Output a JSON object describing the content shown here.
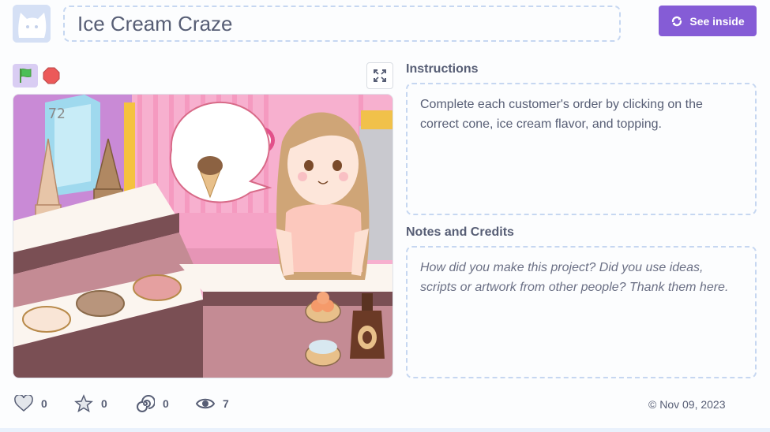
{
  "project": {
    "title": "Ice Cream Craze",
    "see_inside_label": "See inside"
  },
  "stage": {
    "score_text": "72"
  },
  "instructions": {
    "heading": "Instructions",
    "text": "Complete each customer's order by clicking on the correct cone, ice cream flavor, and topping."
  },
  "notes": {
    "heading": "Notes and Credits",
    "placeholder": "How did you make this project? Did you use ideas, scripts or artwork from other people? Thank them here."
  },
  "stats": {
    "loves": "0",
    "favorites": "0",
    "remixes": "0",
    "views": "7"
  },
  "date_text": "© Nov 09, 2023",
  "colors": {
    "accent": "#855cd6",
    "dashed_border": "#c6d7f1",
    "stop_red": "#ec5959",
    "flag_green": "#4cbf56"
  }
}
